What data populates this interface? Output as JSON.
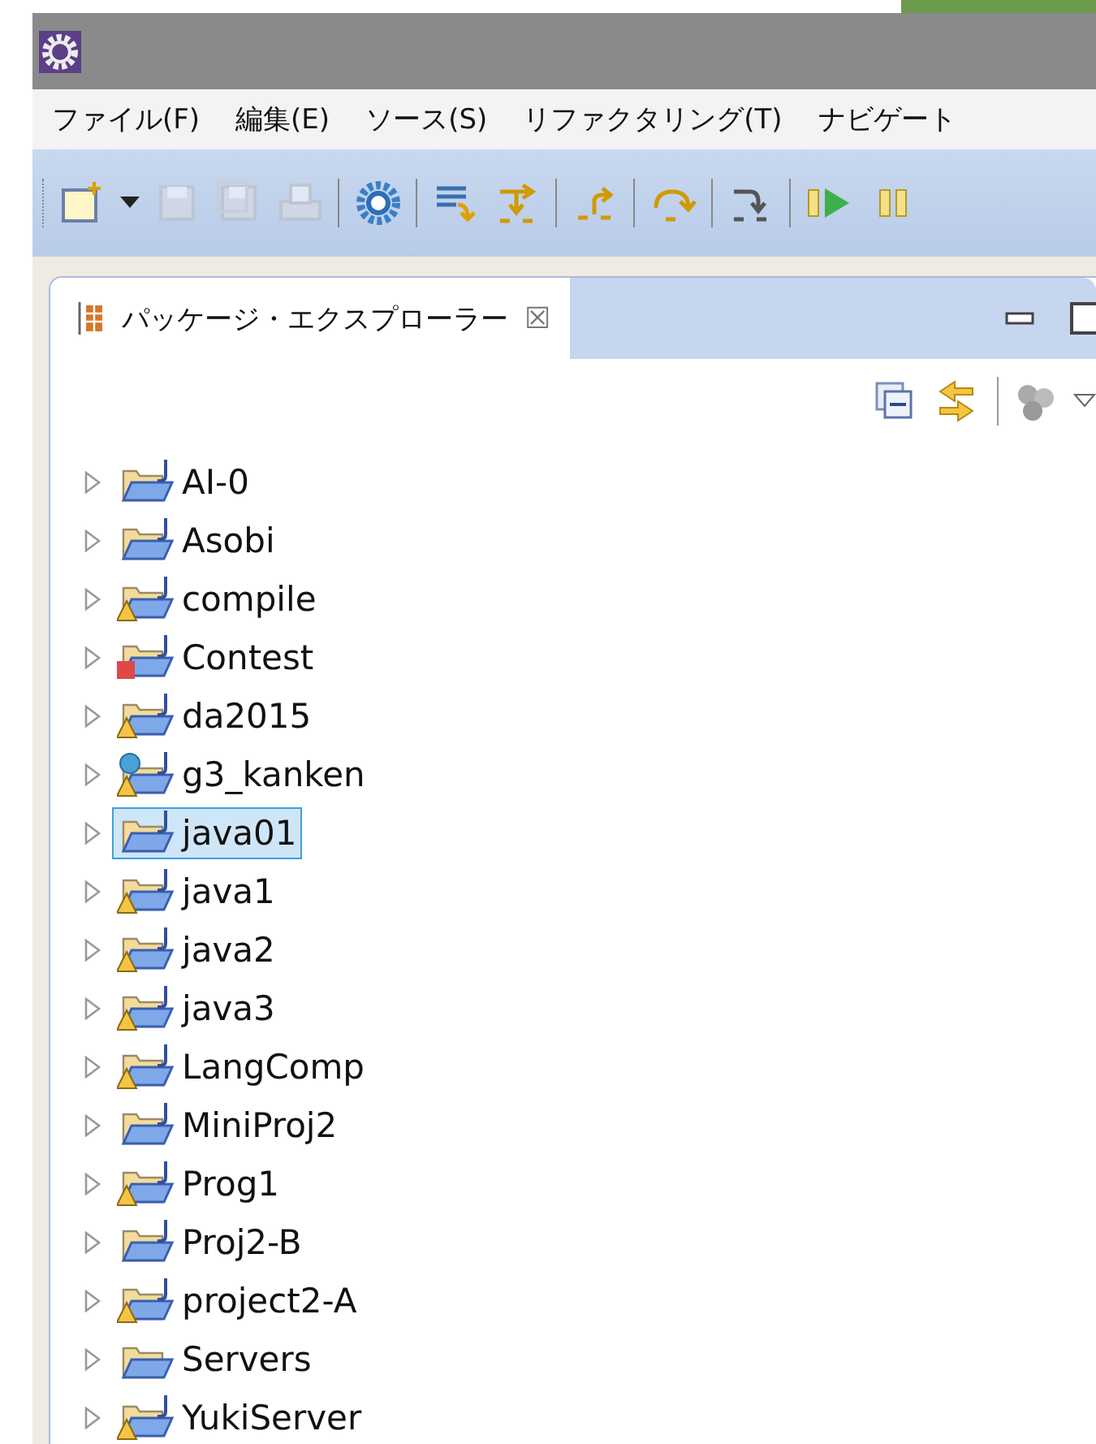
{
  "menu": [
    "ファイル(F)",
    "編集(E)",
    "ソース(S)",
    "リファクタリング(T)",
    "ナビゲート"
  ],
  "toolbar": [
    {
      "kind": "new"
    },
    {
      "kind": "dropdown"
    },
    {
      "kind": "save",
      "disabled": true
    },
    {
      "kind": "save-all",
      "disabled": true
    },
    {
      "kind": "print",
      "disabled": true
    },
    {
      "kind": "sep"
    },
    {
      "kind": "gear"
    },
    {
      "kind": "sep"
    },
    {
      "kind": "lines"
    },
    {
      "kind": "swap"
    },
    {
      "kind": "sep"
    },
    {
      "kind": "step-return"
    },
    {
      "kind": "sep"
    },
    {
      "kind": "step-over"
    },
    {
      "kind": "sep"
    },
    {
      "kind": "step-into"
    },
    {
      "kind": "sep"
    },
    {
      "kind": "resume"
    },
    {
      "kind": "suspend"
    }
  ],
  "view": {
    "title": "パッケージ・エクスプローラー",
    "close": "☒"
  },
  "projects": [
    {
      "name": "AI-0",
      "kind": "java",
      "warning": false,
      "error": false,
      "globe": false,
      "selected": false
    },
    {
      "name": "Asobi",
      "kind": "java",
      "warning": false,
      "error": false,
      "globe": false,
      "selected": false
    },
    {
      "name": "compile",
      "kind": "java",
      "warning": true,
      "error": false,
      "globe": false,
      "selected": false
    },
    {
      "name": "Contest",
      "kind": "java",
      "warning": false,
      "error": true,
      "globe": false,
      "selected": false
    },
    {
      "name": "da2015",
      "kind": "java",
      "warning": true,
      "error": false,
      "globe": false,
      "selected": false
    },
    {
      "name": "g3_kanken",
      "kind": "java",
      "warning": true,
      "error": false,
      "globe": true,
      "selected": false
    },
    {
      "name": "java01",
      "kind": "java",
      "warning": false,
      "error": false,
      "globe": false,
      "selected": true
    },
    {
      "name": "java1",
      "kind": "java",
      "warning": true,
      "error": false,
      "globe": false,
      "selected": false
    },
    {
      "name": "java2",
      "kind": "java",
      "warning": true,
      "error": false,
      "globe": false,
      "selected": false
    },
    {
      "name": "java3",
      "kind": "java",
      "warning": true,
      "error": false,
      "globe": false,
      "selected": false
    },
    {
      "name": "LangComp",
      "kind": "java",
      "warning": true,
      "error": false,
      "globe": false,
      "selected": false
    },
    {
      "name": "MiniProj2",
      "kind": "java",
      "warning": false,
      "error": false,
      "globe": false,
      "selected": false
    },
    {
      "name": "Prog1",
      "kind": "java",
      "warning": true,
      "error": false,
      "globe": false,
      "selected": false
    },
    {
      "name": "Proj2-B",
      "kind": "java",
      "warning": false,
      "error": false,
      "globe": false,
      "selected": false
    },
    {
      "name": "project2-A",
      "kind": "java",
      "warning": true,
      "error": false,
      "globe": false,
      "selected": false
    },
    {
      "name": "Servers",
      "kind": "folder",
      "warning": false,
      "error": false,
      "globe": false,
      "selected": false
    },
    {
      "name": "YukiServer",
      "kind": "java",
      "warning": true,
      "error": false,
      "globe": false,
      "selected": false
    }
  ]
}
